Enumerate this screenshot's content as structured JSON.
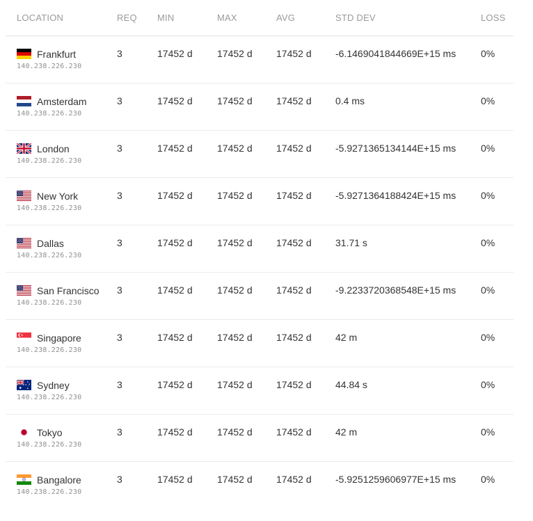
{
  "table": {
    "columns": [
      "LOCATION",
      "REQ",
      "MIN",
      "MAX",
      "AVG",
      "STD DEV",
      "LOSS"
    ],
    "rows": [
      {
        "flag": "de",
        "flag_icon": "germany-flag-icon",
        "location": "Frankfurt",
        "ip": "140.238.226.230",
        "req": "3",
        "min": "17452 d",
        "max": "17452 d",
        "avg": "17452 d",
        "std_dev": "-6.1469041844669E+15 ms",
        "loss": "0%"
      },
      {
        "flag": "nl",
        "flag_icon": "netherlands-flag-icon",
        "location": "Amsterdam",
        "ip": "140.238.226.230",
        "req": "3",
        "min": "17452 d",
        "max": "17452 d",
        "avg": "17452 d",
        "std_dev": "0.4 ms",
        "loss": "0%"
      },
      {
        "flag": "gb",
        "flag_icon": "uk-flag-icon",
        "location": "London",
        "ip": "140.238.226.230",
        "req": "3",
        "min": "17452 d",
        "max": "17452 d",
        "avg": "17452 d",
        "std_dev": "-5.9271365134144E+15 ms",
        "loss": "0%"
      },
      {
        "flag": "us",
        "flag_icon": "usa-flag-icon",
        "location": "New York",
        "ip": "140.238.226.230",
        "req": "3",
        "min": "17452 d",
        "max": "17452 d",
        "avg": "17452 d",
        "std_dev": "-5.9271364188424E+15 ms",
        "loss": "0%"
      },
      {
        "flag": "us",
        "flag_icon": "usa-flag-icon",
        "location": "Dallas",
        "ip": "140.238.226.230",
        "req": "3",
        "min": "17452 d",
        "max": "17452 d",
        "avg": "17452 d",
        "std_dev": "31.71 s",
        "loss": "0%"
      },
      {
        "flag": "us",
        "flag_icon": "usa-flag-icon",
        "location": "San Francisco",
        "ip": "140.238.226.230",
        "req": "3",
        "min": "17452 d",
        "max": "17452 d",
        "avg": "17452 d",
        "std_dev": "-9.2233720368548E+15 ms",
        "loss": "0%"
      },
      {
        "flag": "sg",
        "flag_icon": "singapore-flag-icon",
        "location": "Singapore",
        "ip": "140.238.226.230",
        "req": "3",
        "min": "17452 d",
        "max": "17452 d",
        "avg": "17452 d",
        "std_dev": "42 m",
        "loss": "0%"
      },
      {
        "flag": "au",
        "flag_icon": "australia-flag-icon",
        "location": "Sydney",
        "ip": "140.238.226.230",
        "req": "3",
        "min": "17452 d",
        "max": "17452 d",
        "avg": "17452 d",
        "std_dev": "44.84 s",
        "loss": "0%"
      },
      {
        "flag": "jp",
        "flag_icon": "japan-flag-icon",
        "location": "Tokyo",
        "ip": "140.238.226.230",
        "req": "3",
        "min": "17452 d",
        "max": "17452 d",
        "avg": "17452 d",
        "std_dev": "42 m",
        "loss": "0%"
      },
      {
        "flag": "in",
        "flag_icon": "india-flag-icon",
        "location": "Bangalore",
        "ip": "140.238.226.230",
        "req": "3",
        "min": "17452 d",
        "max": "17452 d",
        "avg": "17452 d",
        "std_dev": "-5.9251259606977E+15 ms",
        "loss": "0%"
      }
    ]
  },
  "colors": {
    "header_text": "#9a9a9a",
    "body_text": "#333333",
    "ip_text": "#8f8f8f",
    "divider": "#ececec"
  }
}
